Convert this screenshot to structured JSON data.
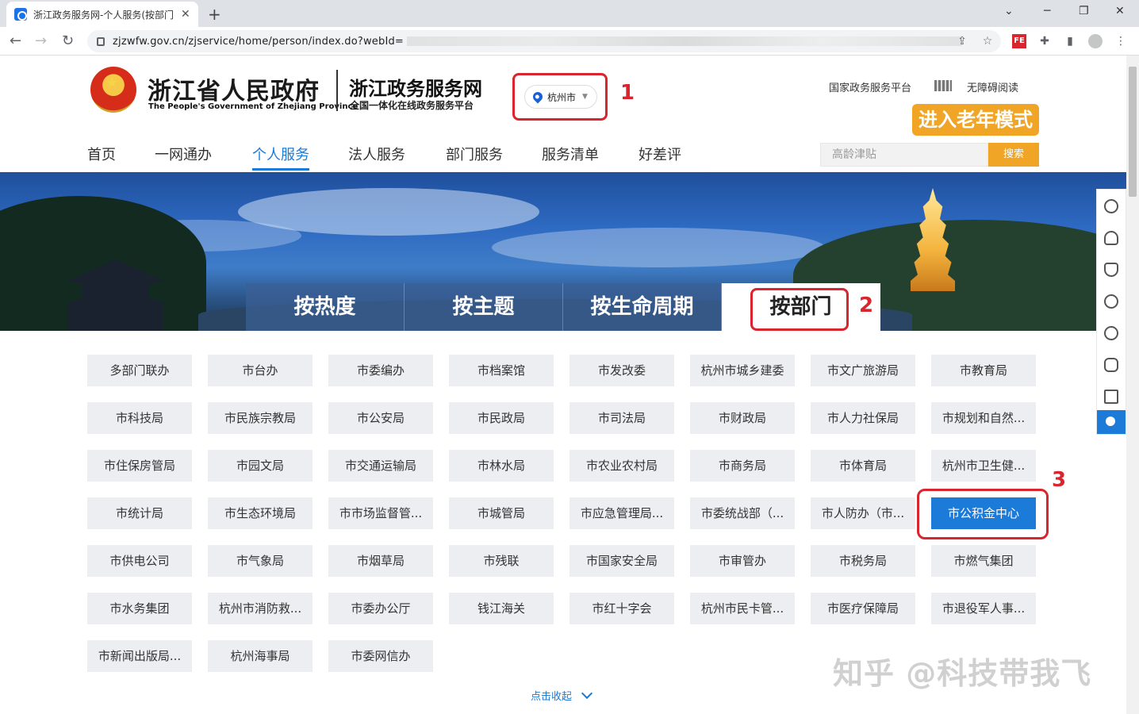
{
  "browser": {
    "tab_title": "浙江政务服务网-个人服务(按部门",
    "tab_close": "✕",
    "new_tab": "+",
    "url": "zjzwfw.gov.cn/zjservice/home/person/index.do?webId=",
    "win_min": "─",
    "win_max": "❐",
    "win_close": "✕"
  },
  "header": {
    "gov_title": "浙江省人民政府",
    "gov_subtitle": "The People's Government of Zhejiang Province",
    "site_title": "浙江政务服务网",
    "site_subtitle": "全国一体化在线政务服务平台",
    "city": "杭州市",
    "link_national": "国家政务服务平台",
    "link_accessible": "无障碍阅读",
    "elder_mode": "进入老年模式",
    "search_placeholder": "高龄津贴",
    "search_button": "搜索"
  },
  "nav": [
    "首页",
    "一网通办",
    "个人服务",
    "法人服务",
    "部门服务",
    "服务清单",
    "好差评"
  ],
  "category_tabs": [
    "按热度",
    "按主题",
    "按生命周期",
    "按部门"
  ],
  "steps": [
    "1",
    "2",
    "3"
  ],
  "departments": [
    [
      "多部门联办",
      "市台办",
      "市委编办",
      "市档案馆",
      "市发改委",
      "杭州市城乡建委",
      "市文广旅游局",
      "市教育局"
    ],
    [
      "市科技局",
      "市民族宗教局",
      "市公安局",
      "市民政局",
      "市司法局",
      "市财政局",
      "市人力社保局",
      "市规划和自然..."
    ],
    [
      "市住保房管局",
      "市园文局",
      "市交通运输局",
      "市林水局",
      "市农业农村局",
      "市商务局",
      "市体育局",
      "杭州市卫生健..."
    ],
    [
      "市统计局",
      "市生态环境局",
      "市市场监督管...",
      "市城管局",
      "市应急管理局...",
      "市委统战部（...",
      "市人防办（市...",
      "市公积金中心"
    ],
    [
      "市供电公司",
      "市气象局",
      "市烟草局",
      "市残联",
      "市国家安全局",
      "市审管办",
      "市税务局",
      "市燃气集团"
    ],
    [
      "市水务集团",
      "杭州市消防救...",
      "市委办公厅",
      "钱江海关",
      "市红十字会",
      "杭州市民卡管...",
      "市医疗保障局",
      "市退役军人事..."
    ],
    [
      "市新闻出版局...",
      "杭州海事局",
      "市委网信办"
    ]
  ],
  "collapse_label": "点击收起",
  "watermark": "知乎 @科技带我飞"
}
